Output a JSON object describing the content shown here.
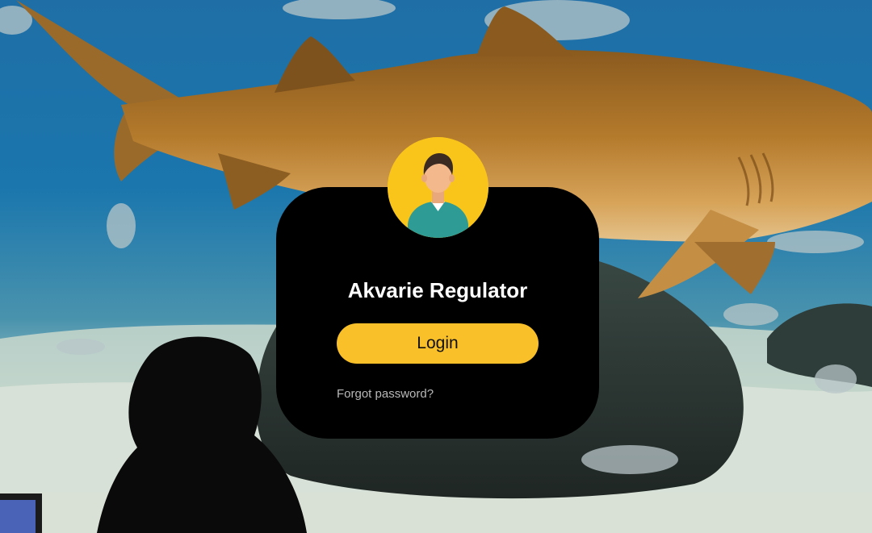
{
  "app": {
    "title": "Akvarie Regulator"
  },
  "login": {
    "button_label": "Login",
    "forgot_password_label": "Forgot password?"
  },
  "icons": {
    "avatar": "user-avatar-icon"
  },
  "colors": {
    "accent": "#f9c02a",
    "card_background": "#000000",
    "title_text": "#ffffff",
    "link_text": "#b9b9b9"
  }
}
